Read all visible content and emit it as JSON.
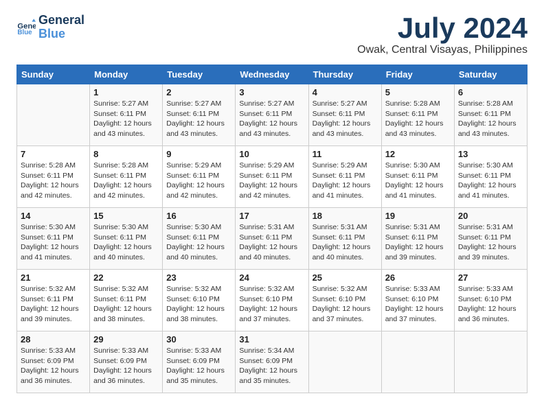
{
  "header": {
    "logo_line1": "General",
    "logo_line2": "Blue",
    "month": "July 2024",
    "location": "Owak, Central Visayas, Philippines"
  },
  "days_of_week": [
    "Sunday",
    "Monday",
    "Tuesday",
    "Wednesday",
    "Thursday",
    "Friday",
    "Saturday"
  ],
  "weeks": [
    [
      {
        "day": "",
        "info": ""
      },
      {
        "day": "1",
        "info": "Sunrise: 5:27 AM\nSunset: 6:11 PM\nDaylight: 12 hours\nand 43 minutes."
      },
      {
        "day": "2",
        "info": "Sunrise: 5:27 AM\nSunset: 6:11 PM\nDaylight: 12 hours\nand 43 minutes."
      },
      {
        "day": "3",
        "info": "Sunrise: 5:27 AM\nSunset: 6:11 PM\nDaylight: 12 hours\nand 43 minutes."
      },
      {
        "day": "4",
        "info": "Sunrise: 5:27 AM\nSunset: 6:11 PM\nDaylight: 12 hours\nand 43 minutes."
      },
      {
        "day": "5",
        "info": "Sunrise: 5:28 AM\nSunset: 6:11 PM\nDaylight: 12 hours\nand 43 minutes."
      },
      {
        "day": "6",
        "info": "Sunrise: 5:28 AM\nSunset: 6:11 PM\nDaylight: 12 hours\nand 43 minutes."
      }
    ],
    [
      {
        "day": "7",
        "info": "Sunrise: 5:28 AM\nSunset: 6:11 PM\nDaylight: 12 hours\nand 42 minutes."
      },
      {
        "day": "8",
        "info": "Sunrise: 5:28 AM\nSunset: 6:11 PM\nDaylight: 12 hours\nand 42 minutes."
      },
      {
        "day": "9",
        "info": "Sunrise: 5:29 AM\nSunset: 6:11 PM\nDaylight: 12 hours\nand 42 minutes."
      },
      {
        "day": "10",
        "info": "Sunrise: 5:29 AM\nSunset: 6:11 PM\nDaylight: 12 hours\nand 42 minutes."
      },
      {
        "day": "11",
        "info": "Sunrise: 5:29 AM\nSunset: 6:11 PM\nDaylight: 12 hours\nand 41 minutes."
      },
      {
        "day": "12",
        "info": "Sunrise: 5:30 AM\nSunset: 6:11 PM\nDaylight: 12 hours\nand 41 minutes."
      },
      {
        "day": "13",
        "info": "Sunrise: 5:30 AM\nSunset: 6:11 PM\nDaylight: 12 hours\nand 41 minutes."
      }
    ],
    [
      {
        "day": "14",
        "info": "Sunrise: 5:30 AM\nSunset: 6:11 PM\nDaylight: 12 hours\nand 41 minutes."
      },
      {
        "day": "15",
        "info": "Sunrise: 5:30 AM\nSunset: 6:11 PM\nDaylight: 12 hours\nand 40 minutes."
      },
      {
        "day": "16",
        "info": "Sunrise: 5:30 AM\nSunset: 6:11 PM\nDaylight: 12 hours\nand 40 minutes."
      },
      {
        "day": "17",
        "info": "Sunrise: 5:31 AM\nSunset: 6:11 PM\nDaylight: 12 hours\nand 40 minutes."
      },
      {
        "day": "18",
        "info": "Sunrise: 5:31 AM\nSunset: 6:11 PM\nDaylight: 12 hours\nand 40 minutes."
      },
      {
        "day": "19",
        "info": "Sunrise: 5:31 AM\nSunset: 6:11 PM\nDaylight: 12 hours\nand 39 minutes."
      },
      {
        "day": "20",
        "info": "Sunrise: 5:31 AM\nSunset: 6:11 PM\nDaylight: 12 hours\nand 39 minutes."
      }
    ],
    [
      {
        "day": "21",
        "info": "Sunrise: 5:32 AM\nSunset: 6:11 PM\nDaylight: 12 hours\nand 39 minutes."
      },
      {
        "day": "22",
        "info": "Sunrise: 5:32 AM\nSunset: 6:11 PM\nDaylight: 12 hours\nand 38 minutes."
      },
      {
        "day": "23",
        "info": "Sunrise: 5:32 AM\nSunset: 6:10 PM\nDaylight: 12 hours\nand 38 minutes."
      },
      {
        "day": "24",
        "info": "Sunrise: 5:32 AM\nSunset: 6:10 PM\nDaylight: 12 hours\nand 37 minutes."
      },
      {
        "day": "25",
        "info": "Sunrise: 5:32 AM\nSunset: 6:10 PM\nDaylight: 12 hours\nand 37 minutes."
      },
      {
        "day": "26",
        "info": "Sunrise: 5:33 AM\nSunset: 6:10 PM\nDaylight: 12 hours\nand 37 minutes."
      },
      {
        "day": "27",
        "info": "Sunrise: 5:33 AM\nSunset: 6:10 PM\nDaylight: 12 hours\nand 36 minutes."
      }
    ],
    [
      {
        "day": "28",
        "info": "Sunrise: 5:33 AM\nSunset: 6:09 PM\nDaylight: 12 hours\nand 36 minutes."
      },
      {
        "day": "29",
        "info": "Sunrise: 5:33 AM\nSunset: 6:09 PM\nDaylight: 12 hours\nand 36 minutes."
      },
      {
        "day": "30",
        "info": "Sunrise: 5:33 AM\nSunset: 6:09 PM\nDaylight: 12 hours\nand 35 minutes."
      },
      {
        "day": "31",
        "info": "Sunrise: 5:34 AM\nSunset: 6:09 PM\nDaylight: 12 hours\nand 35 minutes."
      },
      {
        "day": "",
        "info": ""
      },
      {
        "day": "",
        "info": ""
      },
      {
        "day": "",
        "info": ""
      }
    ]
  ]
}
